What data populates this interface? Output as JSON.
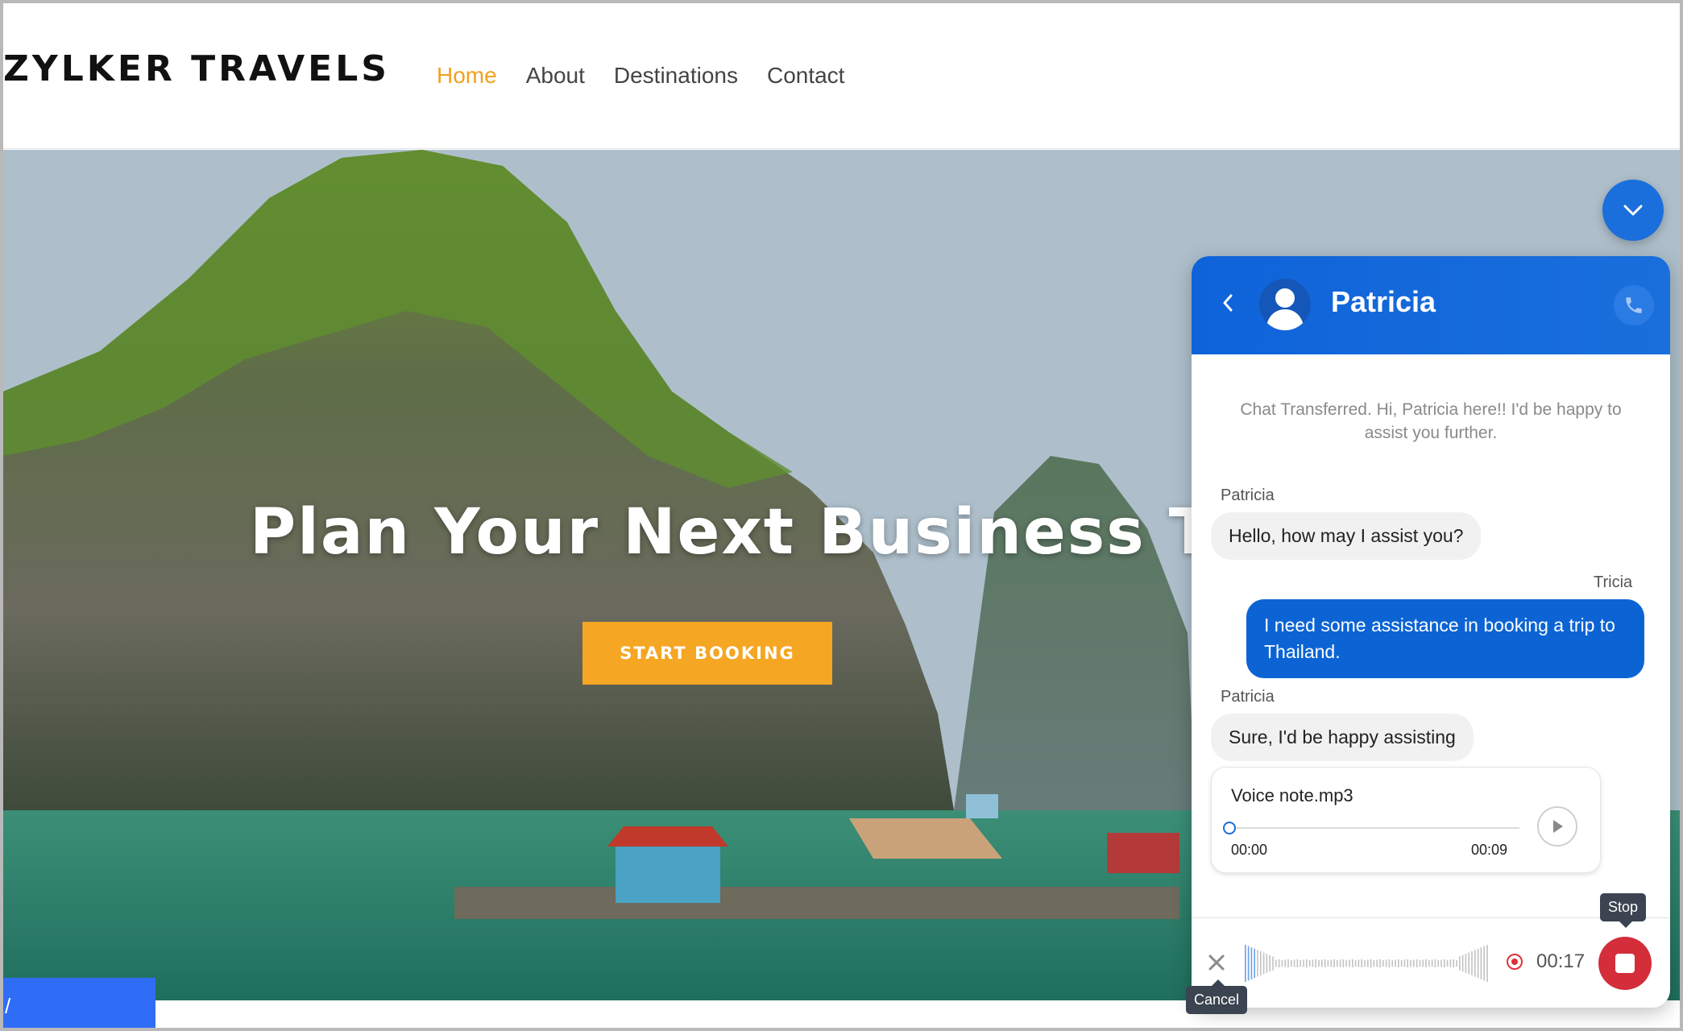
{
  "site": {
    "brand": "ZYLKER TRAVELS",
    "nav": [
      {
        "label": "Home",
        "active": true
      },
      {
        "label": "About",
        "active": false
      },
      {
        "label": "Destinations",
        "active": false
      },
      {
        "label": "Contact",
        "active": false
      }
    ],
    "active_color": "#f0a020"
  },
  "hero": {
    "title": "Plan Your Next Business Trip",
    "cta_label": "START BOOKING",
    "cta_color": "#f5a623"
  },
  "bottom_tab": {
    "label": "/"
  },
  "chat": {
    "header_color": "#1a6fdc",
    "agent_name": "Patricia",
    "icons": [
      "chevron-down-icon",
      "back-icon",
      "avatar-icon",
      "phone-icon"
    ],
    "system_message": "Chat Transferred. Hi, Patricia here!! I'd be happy to assist you further.",
    "messages": [
      {
        "sender": "Patricia",
        "text": "Hello, how may I assist you?",
        "direction": "in"
      },
      {
        "sender": "Tricia",
        "text": "I need some assistance in booking a trip to Thailand.",
        "direction": "out"
      },
      {
        "sender": "Patricia",
        "text": "Sure, I'd be happy assisting",
        "direction": "in"
      }
    ],
    "voice_note": {
      "file_name": "Voice note.mp3",
      "current_time": "00:00",
      "duration": "00:09",
      "progress": 0
    },
    "recorder": {
      "elapsed": "00:17",
      "stop_tooltip": "Stop",
      "cancel_tooltip": "Cancel",
      "stop_color": "#d32e3a"
    }
  }
}
